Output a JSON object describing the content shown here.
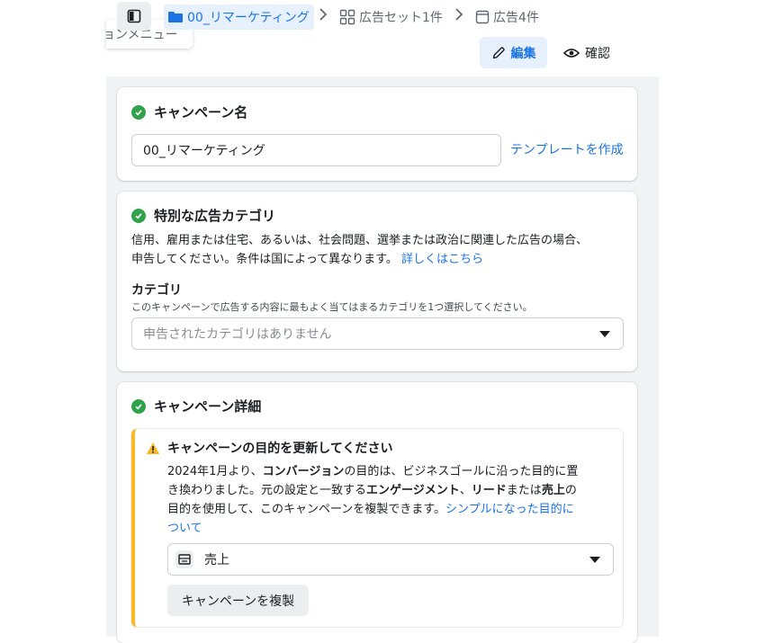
{
  "breadcrumb": {
    "campaign": "00_リマーケティング",
    "adset": "広告セット1件",
    "ad": "広告4件"
  },
  "sidebar_tooltip": "ョンメニュー",
  "toolbar": {
    "edit_label": "編集",
    "review_label": "確認"
  },
  "campaign_name": {
    "title": "キャンペーン名",
    "value": "00_リマーケティング",
    "template_link": "テンプレートを作成"
  },
  "special_category": {
    "title": "特別な広告カテゴリ",
    "desc_line1": "信用、雇用または住宅、あるいは、社会問題、選挙または政治に関連した広告の場合、",
    "desc_line2": "申告してください。条件は国によって異なります。",
    "learn_more": "詳しくはこちら",
    "category_label": "カテゴリ",
    "category_help": "このキャンペーンで広告する内容に最もよく当てはまるカテゴリを1つ選択してください。",
    "select_placeholder": "申告されたカテゴリはありません"
  },
  "campaign_details": {
    "title": "キャンペーン詳細",
    "warning": {
      "heading": "キャンペーンの目的を更新してください",
      "l1_a": "2024年1月より、",
      "l1_b": "コンバージョン",
      "l1_c": "の目的は、ビジネスゴールに沿った目的に置",
      "l2_a": "き換わりました。元の設定と一致する",
      "l2_b": "エンゲージメント",
      "l2_c": "、",
      "l2_d": "リード",
      "l2_e": "または",
      "l2_f": "売上",
      "l2_g": "の",
      "l3_a": "目的を使用して、このキャンペーンを複製できます。",
      "l3_link": "シンプルになった目的に",
      "l4_link": "ついて",
      "objective_value": "売上",
      "duplicate_button": "キャンペーンを複製"
    }
  },
  "colors": {
    "accent": "#1b74e4",
    "success": "#31a24c",
    "warning": "#f7b928"
  }
}
